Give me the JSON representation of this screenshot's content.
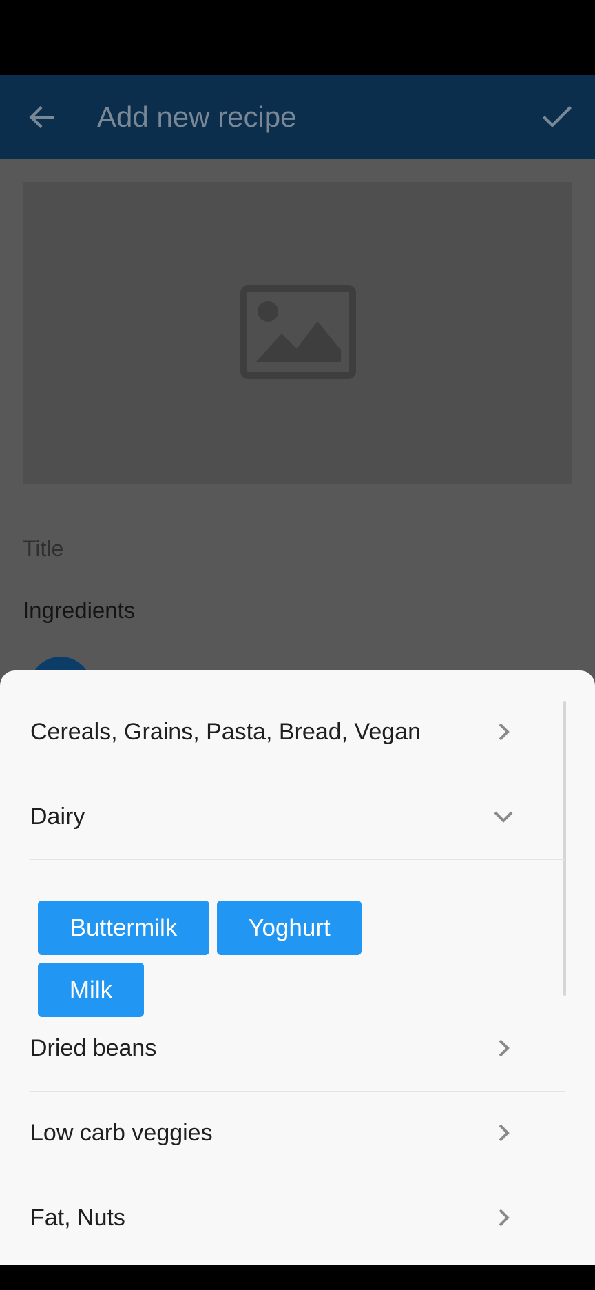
{
  "app_bar": {
    "title": "Add new recipe",
    "back_icon": "arrow-left-icon",
    "confirm_icon": "check-icon"
  },
  "form": {
    "image_icon": "image-placeholder-icon",
    "title_placeholder": "Title",
    "ingredients_label": "Ingredients"
  },
  "categories": {
    "items": [
      {
        "label": "Cereals, Grains, Pasta, Bread, Vegan",
        "expanded": false
      },
      {
        "label": "Dairy",
        "expanded": true
      },
      {
        "label": "Dried beans",
        "expanded": false
      },
      {
        "label": "Low carb veggies",
        "expanded": false
      },
      {
        "label": "Fat, Nuts",
        "expanded": false
      }
    ],
    "dairy_chips": [
      "Buttermilk",
      "Yoghurt",
      "Milk"
    ]
  },
  "colors": {
    "accent": "#2196f3",
    "app_bar": "#0c2e4d"
  }
}
